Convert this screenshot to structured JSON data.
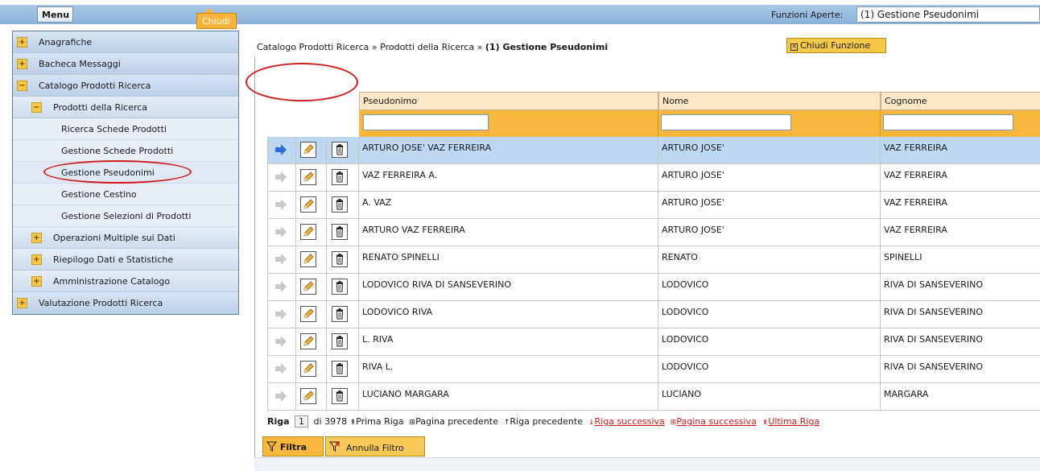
{
  "topbar": {
    "menu_label": "Menu",
    "chiudi_label": "Chiudi",
    "funzioni_label": "Funzioni Aperte:",
    "funzioni_value": "(1) Gestione Pseudonimi"
  },
  "sidebar": {
    "items": [
      {
        "label": "Anagrafiche",
        "toggle": "+"
      },
      {
        "label": "Bacheca Messaggi",
        "toggle": "+"
      },
      {
        "label": "Catalogo Prodotti Ricerca",
        "toggle": "−"
      },
      {
        "label": "Prodotti della Ricerca",
        "toggle": "−"
      },
      {
        "label": "Ricerca Schede Prodotti"
      },
      {
        "label": "Gestione Schede Prodotti"
      },
      {
        "label": "Gestione Pseudonimi"
      },
      {
        "label": "Gestione Cestino"
      },
      {
        "label": "Gestione Selezioni di Prodotti"
      },
      {
        "label": "Operazioni Multiple sui Dati",
        "toggle": "+"
      },
      {
        "label": "Riepilogo Dati e Statistiche",
        "toggle": "+"
      },
      {
        "label": "Amministrazione Catalogo",
        "toggle": "+"
      },
      {
        "label": "Valutazione Prodotti Ricerca",
        "toggle": "+"
      }
    ]
  },
  "breadcrumb": {
    "part1": "Catalogo Prodotti Ricerca",
    "sep": "»",
    "part2": "Prodotti della Ricerca",
    "current": "(1) Gestione Pseudonimi"
  },
  "chiudi_funzione": "Chiudi Funzione",
  "grid": {
    "headers": {
      "pseudonimo": "Pseudonimo",
      "nome": "Nome",
      "cognome": "Cognome"
    },
    "rows": [
      {
        "pseudonimo": "ARTURO JOSE' VAZ FERREIRA",
        "nome": "ARTURO JOSE'",
        "cognome": "VAZ FERREIRA",
        "selected": true
      },
      {
        "pseudonimo": "VAZ FERREIRA A.",
        "nome": "ARTURO JOSE'",
        "cognome": "VAZ FERREIRA"
      },
      {
        "pseudonimo": "A. VAZ",
        "nome": "ARTURO JOSE'",
        "cognome": "VAZ FERREIRA"
      },
      {
        "pseudonimo": "ARTURO VAZ FERREIRA",
        "nome": "ARTURO JOSE'",
        "cognome": "VAZ FERREIRA"
      },
      {
        "pseudonimo": "RENATO SPINELLI",
        "nome": "RENATO",
        "cognome": "SPINELLI"
      },
      {
        "pseudonimo": "LODOVICO RIVA DI SANSEVERINO",
        "nome": "LODOVICO",
        "cognome": "RIVA DI SANSEVERINO"
      },
      {
        "pseudonimo": "LODOVICO RIVA",
        "nome": "LODOVICO",
        "cognome": "RIVA DI SANSEVERINO"
      },
      {
        "pseudonimo": "L. RIVA",
        "nome": "LODOVICO",
        "cognome": "RIVA DI SANSEVERINO"
      },
      {
        "pseudonimo": "RIVA L.",
        "nome": "LODOVICO",
        "cognome": "RIVA DI SANSEVERINO"
      },
      {
        "pseudonimo": "LUCIANO MARGARA",
        "nome": "LUCIANO",
        "cognome": "MARGARA"
      }
    ]
  },
  "pager": {
    "riga_label": "Riga",
    "current": "1",
    "of_total": "di 3978",
    "prima": "Prima Riga",
    "pagina_prec": "Pagina precedente",
    "riga_prec": "Riga precedente",
    "riga_succ": "Riga successiva",
    "pagina_succ": "Pagina successiva",
    "ultima": "Ultima Riga"
  },
  "buttons": {
    "filtra": "Filtra",
    "annulla": "Annulla Filtro"
  },
  "colors": {
    "accent": "#f7b73d",
    "selection": "#bfd8f2",
    "annotation": "#d21a1a"
  }
}
